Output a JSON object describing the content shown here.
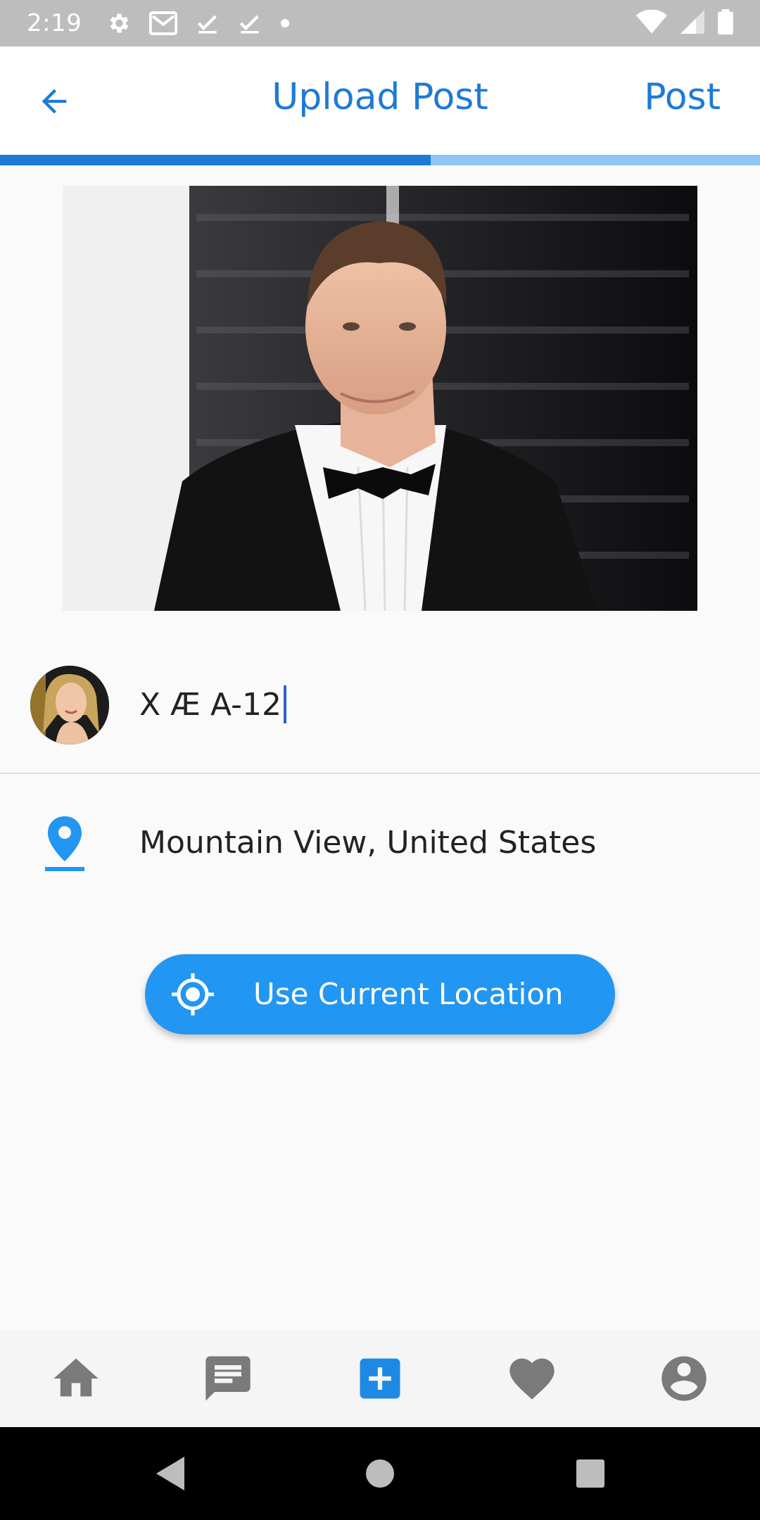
{
  "status_bar": {
    "time": "2:19",
    "left_icons": [
      "settings-icon",
      "gmail-icon",
      "check-icon",
      "check-icon",
      "dot-icon"
    ],
    "right_icons": [
      "wifi-icon",
      "signal-icon",
      "battery-icon"
    ]
  },
  "app_bar": {
    "title": "Upload Post",
    "post_label": "Post",
    "back_icon": "arrow-back-icon"
  },
  "upload_progress": 0.567,
  "caption": {
    "value": "X Æ A-12"
  },
  "location": {
    "value": "Mountain View, United States"
  },
  "use_location_button": {
    "label": "Use Current Location"
  },
  "bottom_nav": {
    "items": [
      "home-icon",
      "chat-icon",
      "add-post-icon",
      "heart-icon",
      "account-icon"
    ],
    "active": "add-post-icon",
    "active_color": "#1e88e5",
    "inactive_color": "#7a7a7a"
  },
  "colors": {
    "primary": "#1e7ad6",
    "button": "#2196f3",
    "progress_track": "#90c6f3"
  }
}
